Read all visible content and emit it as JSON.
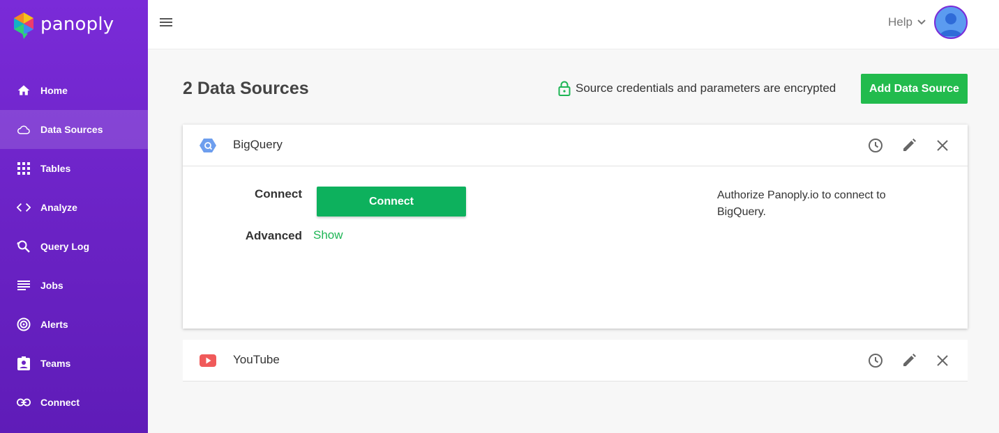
{
  "app": {
    "logo_text": "panoply"
  },
  "sidebar": {
    "items": [
      {
        "label": "Home",
        "icon": "home-icon"
      },
      {
        "label": "Data Sources",
        "icon": "cloud-icon",
        "active": true
      },
      {
        "label": "Tables",
        "icon": "grid-icon"
      },
      {
        "label": "Analyze",
        "icon": "code-icon"
      },
      {
        "label": "Query Log",
        "icon": "search-history-icon"
      },
      {
        "label": "Jobs",
        "icon": "list-icon"
      },
      {
        "label": "Alerts",
        "icon": "alert-target-icon"
      },
      {
        "label": "Teams",
        "icon": "team-badge-icon"
      },
      {
        "label": "Connect",
        "icon": "link-icon"
      }
    ]
  },
  "header": {
    "help_label": "Help"
  },
  "main": {
    "title": "2 Data Sources",
    "encrypted_note": "Source credentials and parameters are encrypted",
    "add_button": "Add Data Source",
    "sources": [
      {
        "name": "BigQuery",
        "expanded": true,
        "connect_label": "Connect",
        "connect_button": "Connect",
        "advanced_label": "Advanced",
        "advanced_link": "Show",
        "description": "Authorize Panoply.io to connect to BigQuery."
      },
      {
        "name": "YouTube",
        "expanded": false
      }
    ]
  },
  "colors": {
    "sidebar": "#6a22c4",
    "accent_green": "#22bb4d",
    "link_green": "#1db554"
  }
}
